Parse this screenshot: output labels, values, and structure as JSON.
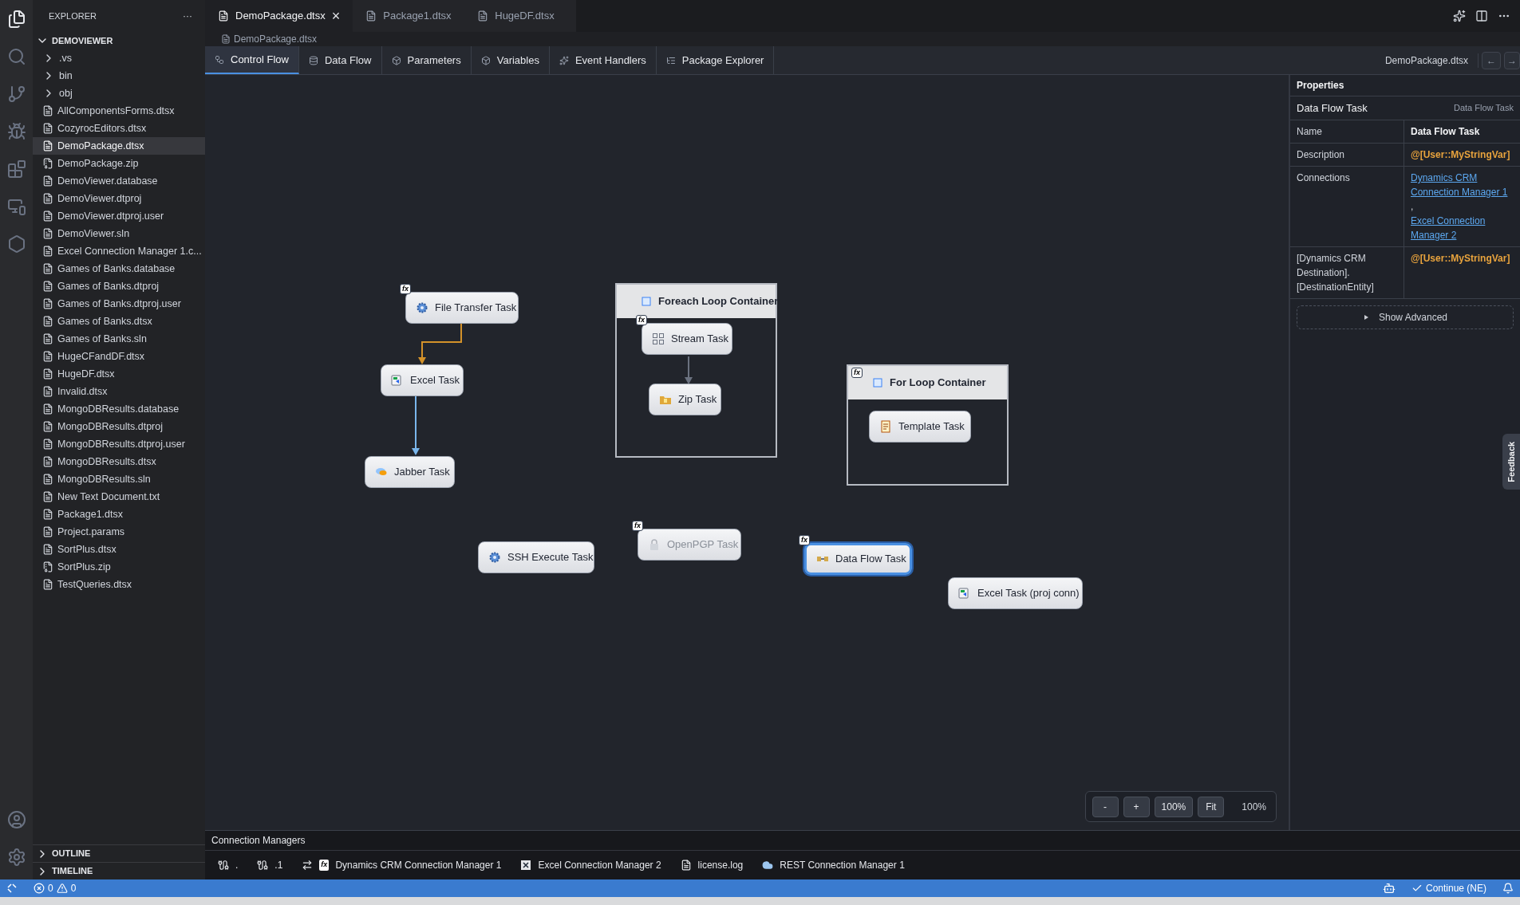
{
  "explorer": {
    "title": "EXPLORER",
    "more": "···",
    "root": "DEMOVIEWER",
    "items": [
      {
        "label": ".vs",
        "kind": "folder",
        "selected": false
      },
      {
        "label": "bin",
        "kind": "folder",
        "selected": false
      },
      {
        "label": "obj",
        "kind": "folder",
        "selected": false
      },
      {
        "label": "AllComponentsForms.dtsx",
        "kind": "file",
        "selected": false
      },
      {
        "label": "CozyrocEditors.dtsx",
        "kind": "file",
        "selected": false
      },
      {
        "label": "DemoPackage.dtsx",
        "kind": "file",
        "selected": true
      },
      {
        "label": "DemoPackage.zip",
        "kind": "zip",
        "selected": false
      },
      {
        "label": "DemoViewer.database",
        "kind": "file",
        "selected": false
      },
      {
        "label": "DemoViewer.dtproj",
        "kind": "file",
        "selected": false
      },
      {
        "label": "DemoViewer.dtproj.user",
        "kind": "file",
        "selected": false
      },
      {
        "label": "DemoViewer.sln",
        "kind": "file",
        "selected": false
      },
      {
        "label": "Excel Connection Manager 1.c...",
        "kind": "file",
        "selected": false
      },
      {
        "label": "Games of Banks.database",
        "kind": "file",
        "selected": false
      },
      {
        "label": "Games of Banks.dtproj",
        "kind": "file",
        "selected": false
      },
      {
        "label": "Games of Banks.dtproj.user",
        "kind": "file",
        "selected": false
      },
      {
        "label": "Games of Banks.dtsx",
        "kind": "file",
        "selected": false
      },
      {
        "label": "Games of Banks.sln",
        "kind": "file",
        "selected": false
      },
      {
        "label": "HugeCFandDF.dtsx",
        "kind": "file",
        "selected": false
      },
      {
        "label": "HugeDF.dtsx",
        "kind": "file",
        "selected": false
      },
      {
        "label": "Invalid.dtsx",
        "kind": "file",
        "selected": false
      },
      {
        "label": "MongoDBResults.database",
        "kind": "file",
        "selected": false
      },
      {
        "label": "MongoDBResults.dtproj",
        "kind": "file",
        "selected": false
      },
      {
        "label": "MongoDBResults.dtproj.user",
        "kind": "file",
        "selected": false
      },
      {
        "label": "MongoDBResults.dtsx",
        "kind": "file",
        "selected": false
      },
      {
        "label": "MongoDBResults.sln",
        "kind": "file",
        "selected": false
      },
      {
        "label": "New Text Document.txt",
        "kind": "file",
        "selected": false
      },
      {
        "label": "Package1.dtsx",
        "kind": "file",
        "selected": false
      },
      {
        "label": "Project.params",
        "kind": "file",
        "selected": false
      },
      {
        "label": "SortPlus.dtsx",
        "kind": "file",
        "selected": false
      },
      {
        "label": "SortPlus.zip",
        "kind": "zip",
        "selected": false
      },
      {
        "label": "TestQueries.dtsx",
        "kind": "file",
        "selected": false
      }
    ],
    "sections": [
      {
        "label": "OUTLINE",
        "expanded": false
      },
      {
        "label": "TIMELINE",
        "expanded": false
      }
    ]
  },
  "editor_tabs": [
    {
      "label": "DemoPackage.dtsx",
      "selected": true
    },
    {
      "label": "Package1.dtsx",
      "selected": false
    },
    {
      "label": "HugeDF.dtsx",
      "selected": false
    }
  ],
  "close_glyph": "×",
  "breadcrumb": "DemoPackage.dtsx",
  "designer_tabs": [
    {
      "label": "Control Flow",
      "selected": true
    },
    {
      "label": "Data Flow",
      "selected": false
    },
    {
      "label": "Parameters",
      "selected": false
    },
    {
      "label": "Variables",
      "selected": false
    },
    {
      "label": "Event Handlers",
      "selected": false
    },
    {
      "label": "Package Explorer",
      "selected": false
    }
  ],
  "designer_file": "DemoPackage.dtsx",
  "nav": {
    "back": "←",
    "forward": "→"
  },
  "canvas": {
    "nodes": [
      {
        "kind": "task",
        "label": "File Transfer Task",
        "badge": "fx",
        "selected": false,
        "disabled": false
      },
      {
        "kind": "task",
        "label": "Excel Task",
        "selected": false,
        "disabled": false
      },
      {
        "kind": "task",
        "label": "Jabber Task",
        "selected": false,
        "disabled": false
      },
      {
        "kind": "container",
        "label": "Foreach Loop Container",
        "children": [
          {
            "kind": "task",
            "label": "Stream Task",
            "badge": "fx",
            "selected": false,
            "disabled": false
          },
          {
            "kind": "task",
            "label": "Zip Task",
            "selected": false,
            "disabled": false
          }
        ]
      },
      {
        "kind": "container",
        "label": "For Loop Container",
        "badge": "fx",
        "children": [
          {
            "kind": "task",
            "label": "Template Task",
            "selected": false,
            "disabled": false
          }
        ]
      },
      {
        "kind": "task",
        "label": "SSH Execute Task",
        "selected": false,
        "disabled": false
      },
      {
        "kind": "task",
        "label": "OpenPGP Task",
        "badge": "fx",
        "selected": false,
        "disabled": true
      },
      {
        "kind": "task",
        "label": "Data Flow Task",
        "badge": "fx",
        "selected": true,
        "disabled": false
      },
      {
        "kind": "task",
        "label": "Excel Task (proj conn)",
        "selected": false,
        "disabled": false
      }
    ]
  },
  "zoom": {
    "buttons": [
      "-",
      "+",
      "100%",
      "Fit"
    ],
    "reading": "100%"
  },
  "properties": {
    "header": "Properties",
    "title": "Data Flow Task",
    "type": "Data Flow Task",
    "rows": [
      {
        "name": "Name",
        "kind": "text",
        "value": "Data Flow Task"
      },
      {
        "name": "Description",
        "kind": "expression",
        "value": "@[User::MyStringVar]"
      },
      {
        "name": "Connections",
        "kind": "links",
        "links": [
          "Dynamics CRM Connection Manager 1",
          "Excel Connection Manager 2"
        ],
        "separator": ","
      },
      {
        "name": "[Dynamics CRM Destination].[DestinationEntity]",
        "kind": "expression",
        "value": "@[User::MyStringVar]"
      }
    ],
    "show_advanced": "Show Advanced",
    "feedback": "Feedback"
  },
  "connection_managers": {
    "title": "Connection Managers",
    "items": [
      {
        "label": "."
      },
      {
        "label": ".1"
      },
      {
        "label": "Dynamics CRM Connection Manager 1",
        "badge": "fx"
      },
      {
        "label": "Excel Connection Manager 2"
      },
      {
        "label": "license.log"
      },
      {
        "label": "REST Connection Manager 1"
      }
    ]
  },
  "status_bar": {
    "errors": "0",
    "warnings": "0",
    "continue": "Continue (NE)"
  }
}
